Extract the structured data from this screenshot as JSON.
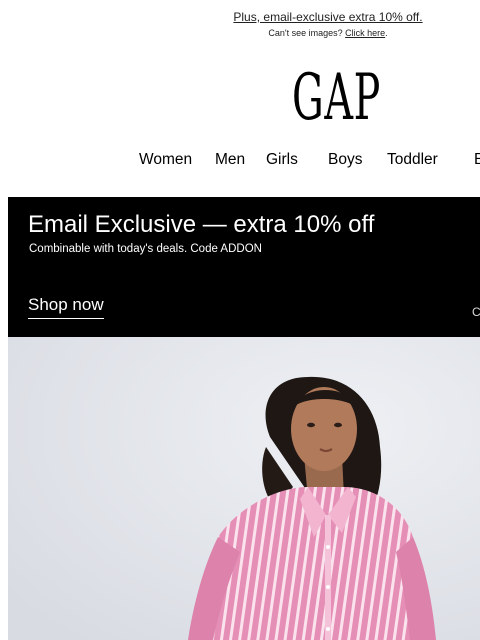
{
  "preheader": {
    "promo_link": "Plus, email-exclusive extra 10% off.",
    "cant_see_text": "Can't see images?",
    "click_here_link": "Click here"
  },
  "logo": {
    "text": "GAP"
  },
  "nav": {
    "items": [
      "Women",
      "Men",
      "Girls",
      "Boys",
      "Toddler",
      "B"
    ]
  },
  "banner": {
    "headline": "Email Exclusive — extra 10% off",
    "subline": "Combinable with today's deals. Code ADDON",
    "cta": "Shop now",
    "edge_glyph": "C"
  },
  "hero": {
    "description_icon": "model-photo",
    "colors": {
      "shirt": "#e58fb6",
      "stripe": "#ffffff",
      "background": "#e3e5eb"
    }
  }
}
